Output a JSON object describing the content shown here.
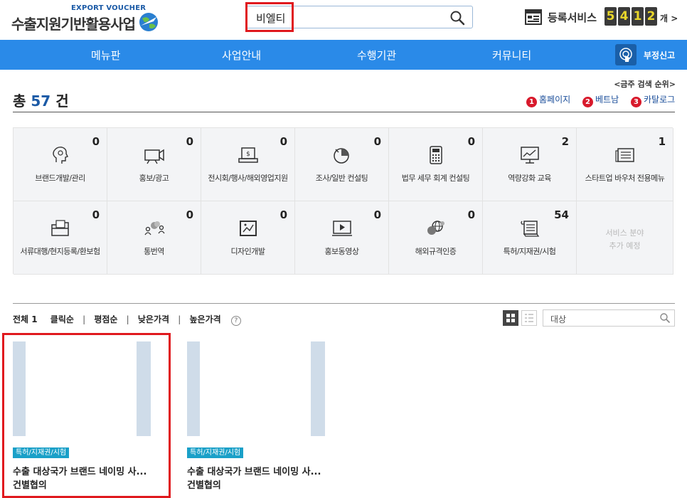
{
  "header": {
    "logo_sub": "EXPORT VOUCHER",
    "logo_main": "수출지원기반활용사업",
    "search_value": "비엘티",
    "registered_label": "등록서비스",
    "registered_digits": [
      "5",
      "4",
      "1",
      "2"
    ],
    "registered_unit": "개 >"
  },
  "nav": {
    "items": [
      "메뉴판",
      "사업안내",
      "수행기관",
      "커뮤니티"
    ],
    "report_label": "부정신고"
  },
  "summary": {
    "total_prefix": "총",
    "total_count": "57",
    "total_suffix": "건",
    "ranking_title": "<금주 검색 순위>",
    "ranking": [
      {
        "rank": "1",
        "term": "홈페이지"
      },
      {
        "rank": "2",
        "term": "베트남"
      },
      {
        "rank": "3",
        "term": "카탈로그"
      }
    ]
  },
  "categories": [
    {
      "label": "브랜드개발/관리",
      "count": "0",
      "icon": "lightbulb-head-icon"
    },
    {
      "label": "홍보/광고",
      "count": "0",
      "icon": "video-camera-icon"
    },
    {
      "label": "전시회/행사/해외영업지원",
      "count": "0",
      "icon": "booth-icon"
    },
    {
      "label": "조사/일반 컨설팅",
      "count": "0",
      "icon": "pie-chart-icon"
    },
    {
      "label": "법무 세무 회계 컨설팅",
      "count": "0",
      "icon": "calculator-icon"
    },
    {
      "label": "역량강화 교육",
      "count": "2",
      "icon": "monitor-chart-icon"
    },
    {
      "label": "스타트업 바우처 전용메뉴",
      "count": "1",
      "icon": "document-icon"
    },
    {
      "label": "서류대행/현지등록/환보험",
      "count": "0",
      "icon": "folder-icon"
    },
    {
      "label": "통번역",
      "count": "0",
      "icon": "people-chat-icon"
    },
    {
      "label": "디자인개발",
      "count": "0",
      "icon": "design-frame-icon"
    },
    {
      "label": "홍보동영상",
      "count": "0",
      "icon": "play-video-icon"
    },
    {
      "label": "해외규격인증",
      "count": "0",
      "icon": "globe-cert-icon"
    },
    {
      "label": "특허/지재권/시험",
      "count": "54",
      "icon": "patent-scroll-icon"
    }
  ],
  "coming_soon": "서비스 분야\n추가 예정",
  "sort": {
    "all_label": "전체 1",
    "options": [
      "클릭순",
      "평점순",
      "낮은가격",
      "높은가격"
    ],
    "help": "?",
    "filter_value": "대상"
  },
  "cards": [
    {
      "tag": "특허/지재권/시험",
      "title": "수출 대상국가 브랜드 네이밍 사...",
      "price": "건별협의"
    },
    {
      "tag": "특허/지재권/시험",
      "title": "수출 대상국가 브랜드 네이밍 사...",
      "price": "건별협의"
    }
  ],
  "colors": {
    "nav_bg": "#2a8ae8",
    "brand_blue": "#1b5aa6",
    "highlight_red": "#e0191e",
    "tag_bg": "#1aa0c8",
    "rank_badge": "#d8192b"
  }
}
